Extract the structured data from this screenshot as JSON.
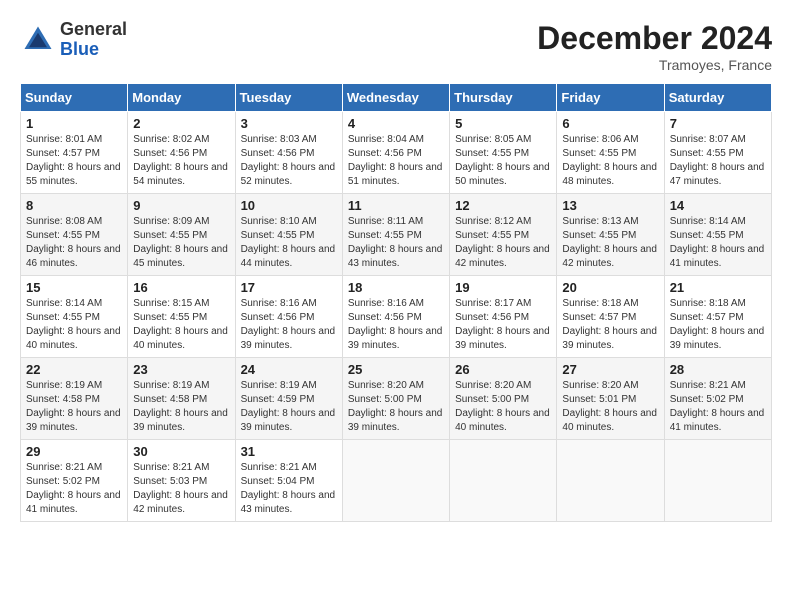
{
  "header": {
    "logo_general": "General",
    "logo_blue": "Blue",
    "month_title": "December 2024",
    "location": "Tramoyes, France"
  },
  "calendar": {
    "weekdays": [
      "Sunday",
      "Monday",
      "Tuesday",
      "Wednesday",
      "Thursday",
      "Friday",
      "Saturday"
    ],
    "rows": [
      [
        {
          "day": "1",
          "sunrise": "8:01 AM",
          "sunset": "4:57 PM",
          "daylight": "8 hours and 55 minutes."
        },
        {
          "day": "2",
          "sunrise": "8:02 AM",
          "sunset": "4:56 PM",
          "daylight": "8 hours and 54 minutes."
        },
        {
          "day": "3",
          "sunrise": "8:03 AM",
          "sunset": "4:56 PM",
          "daylight": "8 hours and 52 minutes."
        },
        {
          "day": "4",
          "sunrise": "8:04 AM",
          "sunset": "4:56 PM",
          "daylight": "8 hours and 51 minutes."
        },
        {
          "day": "5",
          "sunrise": "8:05 AM",
          "sunset": "4:55 PM",
          "daylight": "8 hours and 50 minutes."
        },
        {
          "day": "6",
          "sunrise": "8:06 AM",
          "sunset": "4:55 PM",
          "daylight": "8 hours and 48 minutes."
        },
        {
          "day": "7",
          "sunrise": "8:07 AM",
          "sunset": "4:55 PM",
          "daylight": "8 hours and 47 minutes."
        }
      ],
      [
        {
          "day": "8",
          "sunrise": "8:08 AM",
          "sunset": "4:55 PM",
          "daylight": "8 hours and 46 minutes."
        },
        {
          "day": "9",
          "sunrise": "8:09 AM",
          "sunset": "4:55 PM",
          "daylight": "8 hours and 45 minutes."
        },
        {
          "day": "10",
          "sunrise": "8:10 AM",
          "sunset": "4:55 PM",
          "daylight": "8 hours and 44 minutes."
        },
        {
          "day": "11",
          "sunrise": "8:11 AM",
          "sunset": "4:55 PM",
          "daylight": "8 hours and 43 minutes."
        },
        {
          "day": "12",
          "sunrise": "8:12 AM",
          "sunset": "4:55 PM",
          "daylight": "8 hours and 42 minutes."
        },
        {
          "day": "13",
          "sunrise": "8:13 AM",
          "sunset": "4:55 PM",
          "daylight": "8 hours and 42 minutes."
        },
        {
          "day": "14",
          "sunrise": "8:14 AM",
          "sunset": "4:55 PM",
          "daylight": "8 hours and 41 minutes."
        }
      ],
      [
        {
          "day": "15",
          "sunrise": "8:14 AM",
          "sunset": "4:55 PM",
          "daylight": "8 hours and 40 minutes."
        },
        {
          "day": "16",
          "sunrise": "8:15 AM",
          "sunset": "4:55 PM",
          "daylight": "8 hours and 40 minutes."
        },
        {
          "day": "17",
          "sunrise": "8:16 AM",
          "sunset": "4:56 PM",
          "daylight": "8 hours and 39 minutes."
        },
        {
          "day": "18",
          "sunrise": "8:16 AM",
          "sunset": "4:56 PM",
          "daylight": "8 hours and 39 minutes."
        },
        {
          "day": "19",
          "sunrise": "8:17 AM",
          "sunset": "4:56 PM",
          "daylight": "8 hours and 39 minutes."
        },
        {
          "day": "20",
          "sunrise": "8:18 AM",
          "sunset": "4:57 PM",
          "daylight": "8 hours and 39 minutes."
        },
        {
          "day": "21",
          "sunrise": "8:18 AM",
          "sunset": "4:57 PM",
          "daylight": "8 hours and 39 minutes."
        }
      ],
      [
        {
          "day": "22",
          "sunrise": "8:19 AM",
          "sunset": "4:58 PM",
          "daylight": "8 hours and 39 minutes."
        },
        {
          "day": "23",
          "sunrise": "8:19 AM",
          "sunset": "4:58 PM",
          "daylight": "8 hours and 39 minutes."
        },
        {
          "day": "24",
          "sunrise": "8:19 AM",
          "sunset": "4:59 PM",
          "daylight": "8 hours and 39 minutes."
        },
        {
          "day": "25",
          "sunrise": "8:20 AM",
          "sunset": "5:00 PM",
          "daylight": "8 hours and 39 minutes."
        },
        {
          "day": "26",
          "sunrise": "8:20 AM",
          "sunset": "5:00 PM",
          "daylight": "8 hours and 40 minutes."
        },
        {
          "day": "27",
          "sunrise": "8:20 AM",
          "sunset": "5:01 PM",
          "daylight": "8 hours and 40 minutes."
        },
        {
          "day": "28",
          "sunrise": "8:21 AM",
          "sunset": "5:02 PM",
          "daylight": "8 hours and 41 minutes."
        }
      ],
      [
        {
          "day": "29",
          "sunrise": "8:21 AM",
          "sunset": "5:02 PM",
          "daylight": "8 hours and 41 minutes."
        },
        {
          "day": "30",
          "sunrise": "8:21 AM",
          "sunset": "5:03 PM",
          "daylight": "8 hours and 42 minutes."
        },
        {
          "day": "31",
          "sunrise": "8:21 AM",
          "sunset": "5:04 PM",
          "daylight": "8 hours and 43 minutes."
        },
        null,
        null,
        null,
        null
      ]
    ]
  }
}
